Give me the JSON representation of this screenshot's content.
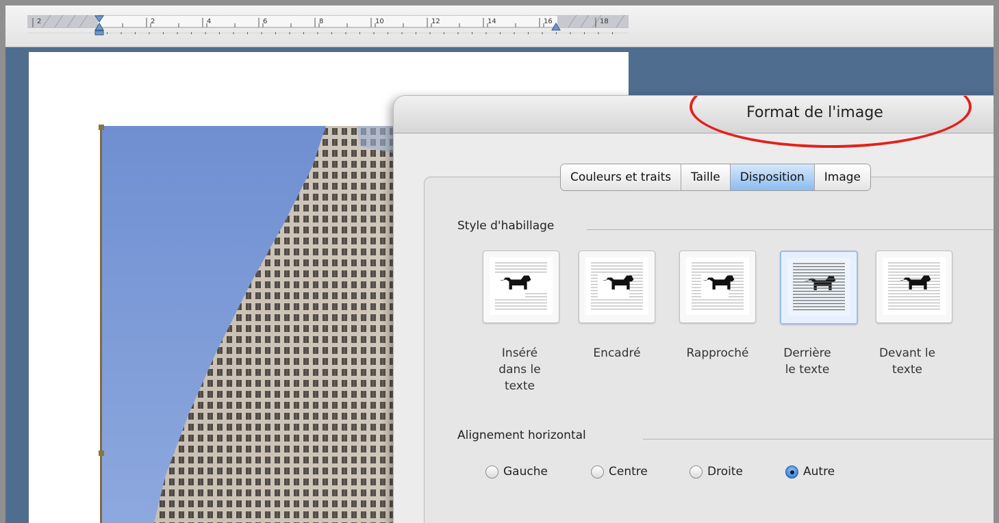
{
  "ruler": {
    "labels": [
      "2",
      "2",
      "4",
      "6",
      "8",
      "10",
      "12",
      "14",
      "16",
      "18"
    ]
  },
  "dialog": {
    "title": "Format de l'image",
    "highlight_color": "#e4201a",
    "tabs": [
      {
        "label": "Couleurs et traits",
        "selected": false
      },
      {
        "label": "Taille",
        "selected": false
      },
      {
        "label": "Disposition",
        "selected": true
      },
      {
        "label": "Image",
        "selected": false
      }
    ],
    "wrap_section": {
      "label": "Style d'habillage",
      "options": [
        {
          "label": "Inséré dans le texte",
          "icon": "inline-wrap-icon",
          "selected": false
        },
        {
          "label": "Encadré",
          "icon": "square-wrap-icon",
          "selected": false
        },
        {
          "label": "Rapproché",
          "icon": "tight-wrap-icon",
          "selected": false
        },
        {
          "label": "Derrière le texte",
          "icon": "behind-text-icon",
          "selected": true
        },
        {
          "label": "Devant le texte",
          "icon": "in-front-of-text-icon",
          "selected": false
        }
      ]
    },
    "alignment_section": {
      "label": "Alignement horizontal",
      "options": [
        {
          "label": "Gauche",
          "checked": false
        },
        {
          "label": "Centre",
          "checked": false
        },
        {
          "label": "Droite",
          "checked": false
        },
        {
          "label": "Autre",
          "checked": true
        }
      ]
    }
  },
  "colors": {
    "selected_tab": "#8cbcee",
    "workspace": "#4f6d8f",
    "highlight": "#e4201a"
  }
}
